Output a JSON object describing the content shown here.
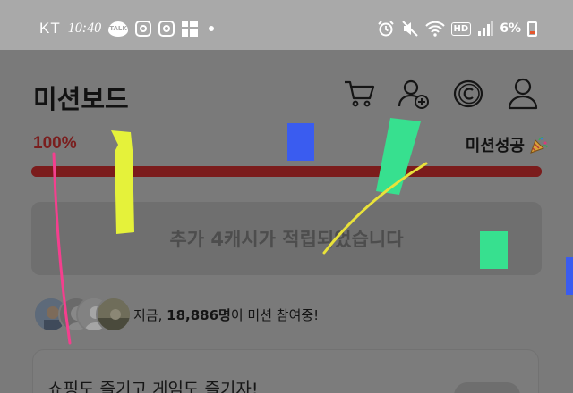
{
  "statusbar": {
    "carrier": "KT",
    "time": "10:40",
    "talk_badge": "TALK",
    "hd_badge": "HD",
    "battery": "6%",
    "icons": [
      "kakaotalk-icon",
      "instagram-icon",
      "instagram-icon",
      "app-grid-icon",
      "alarm-icon",
      "mute-icon",
      "wifi-icon",
      "hd-icon",
      "signal-icon",
      "battery-icon"
    ]
  },
  "header": {
    "title": "미션보드",
    "icons": [
      "cart-icon",
      "add-friend-icon",
      "coin-icon",
      "profile-icon"
    ]
  },
  "progress": {
    "label": "100%",
    "value": 1.0,
    "success_label": "미션성공",
    "success_icon": "party-popper-icon",
    "color": "#7b1c1c"
  },
  "notice": {
    "text": "추가 4캐시가 적립되었습니다"
  },
  "participants": {
    "prefix": "지금, ",
    "count": "18,886명",
    "suffix": "이 미션 참여중!"
  },
  "card": {
    "title": "쇼핑도 즐기고 게임도 즐기자!"
  },
  "annotations": {
    "colors": [
      "#f43f8e",
      "#e5f23a",
      "#3a5cf0",
      "#37e08f",
      "#e9e23a",
      "#37e08f",
      "#3a5cf0"
    ]
  }
}
